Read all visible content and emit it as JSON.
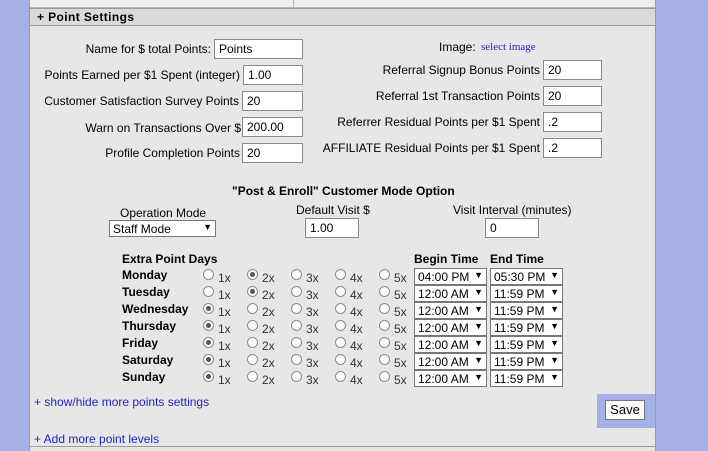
{
  "section": {
    "title": "+ Point Settings"
  },
  "left_fields": [
    {
      "label": "Name for $ total Points:",
      "value": "Points"
    },
    {
      "label": "Points Earned per $1 Spent (integer)",
      "value": "1.00"
    },
    {
      "label": "Customer Satisfaction Survey Points",
      "value": "20"
    },
    {
      "label": "Warn on Transactions Over $",
      "value": "200.00"
    },
    {
      "label": "Profile Completion Points",
      "value": "20"
    }
  ],
  "image": {
    "label": "Image:",
    "link": "select image"
  },
  "right_fields": [
    {
      "label": "Referral Signup Bonus Points",
      "value": "20"
    },
    {
      "label": "Referral 1st Transaction Points",
      "value": "20"
    },
    {
      "label": "Referrer Residual Points per $1 Spent",
      "value": ".2"
    },
    {
      "label": "AFFILIATE Residual Points per $1 Spent",
      "value": ".2"
    }
  ],
  "post_enroll": {
    "title": "\"Post & Enroll\" Customer Mode Option",
    "operation_mode_label": "Operation Mode",
    "operation_mode_value": "Staff Mode",
    "default_visit_label": "Default Visit $",
    "default_visit_value": "1.00",
    "visit_interval_label": "Visit Interval (minutes)",
    "visit_interval_value": "0"
  },
  "extra_days": {
    "header": "Extra Point Days",
    "begin_header": "Begin Time",
    "end_header": "End Time",
    "multipliers": [
      "1x",
      "2x",
      "3x",
      "4x",
      "5x"
    ],
    "rows": [
      {
        "day": "Monday",
        "selected": 1,
        "begin": "04:00 PM",
        "end": "05:30 PM"
      },
      {
        "day": "Tuesday",
        "selected": 1,
        "begin": "12:00 AM",
        "end": "11:59 PM"
      },
      {
        "day": "Wednesday",
        "selected": 0,
        "begin": "12:00 AM",
        "end": "11:59 PM"
      },
      {
        "day": "Thursday",
        "selected": 0,
        "begin": "12:00 AM",
        "end": "11:59 PM"
      },
      {
        "day": "Friday",
        "selected": 0,
        "begin": "12:00 AM",
        "end": "11:59 PM"
      },
      {
        "day": "Saturday",
        "selected": 0,
        "begin": "12:00 AM",
        "end": "11:59 PM"
      },
      {
        "day": "Sunday",
        "selected": 0,
        "begin": "12:00 AM",
        "end": "11:59 PM"
      }
    ]
  },
  "links": {
    "show_hide": "+ show/hide more points settings",
    "add_levels": "+ Add more point levels"
  },
  "save_label": "Save"
}
